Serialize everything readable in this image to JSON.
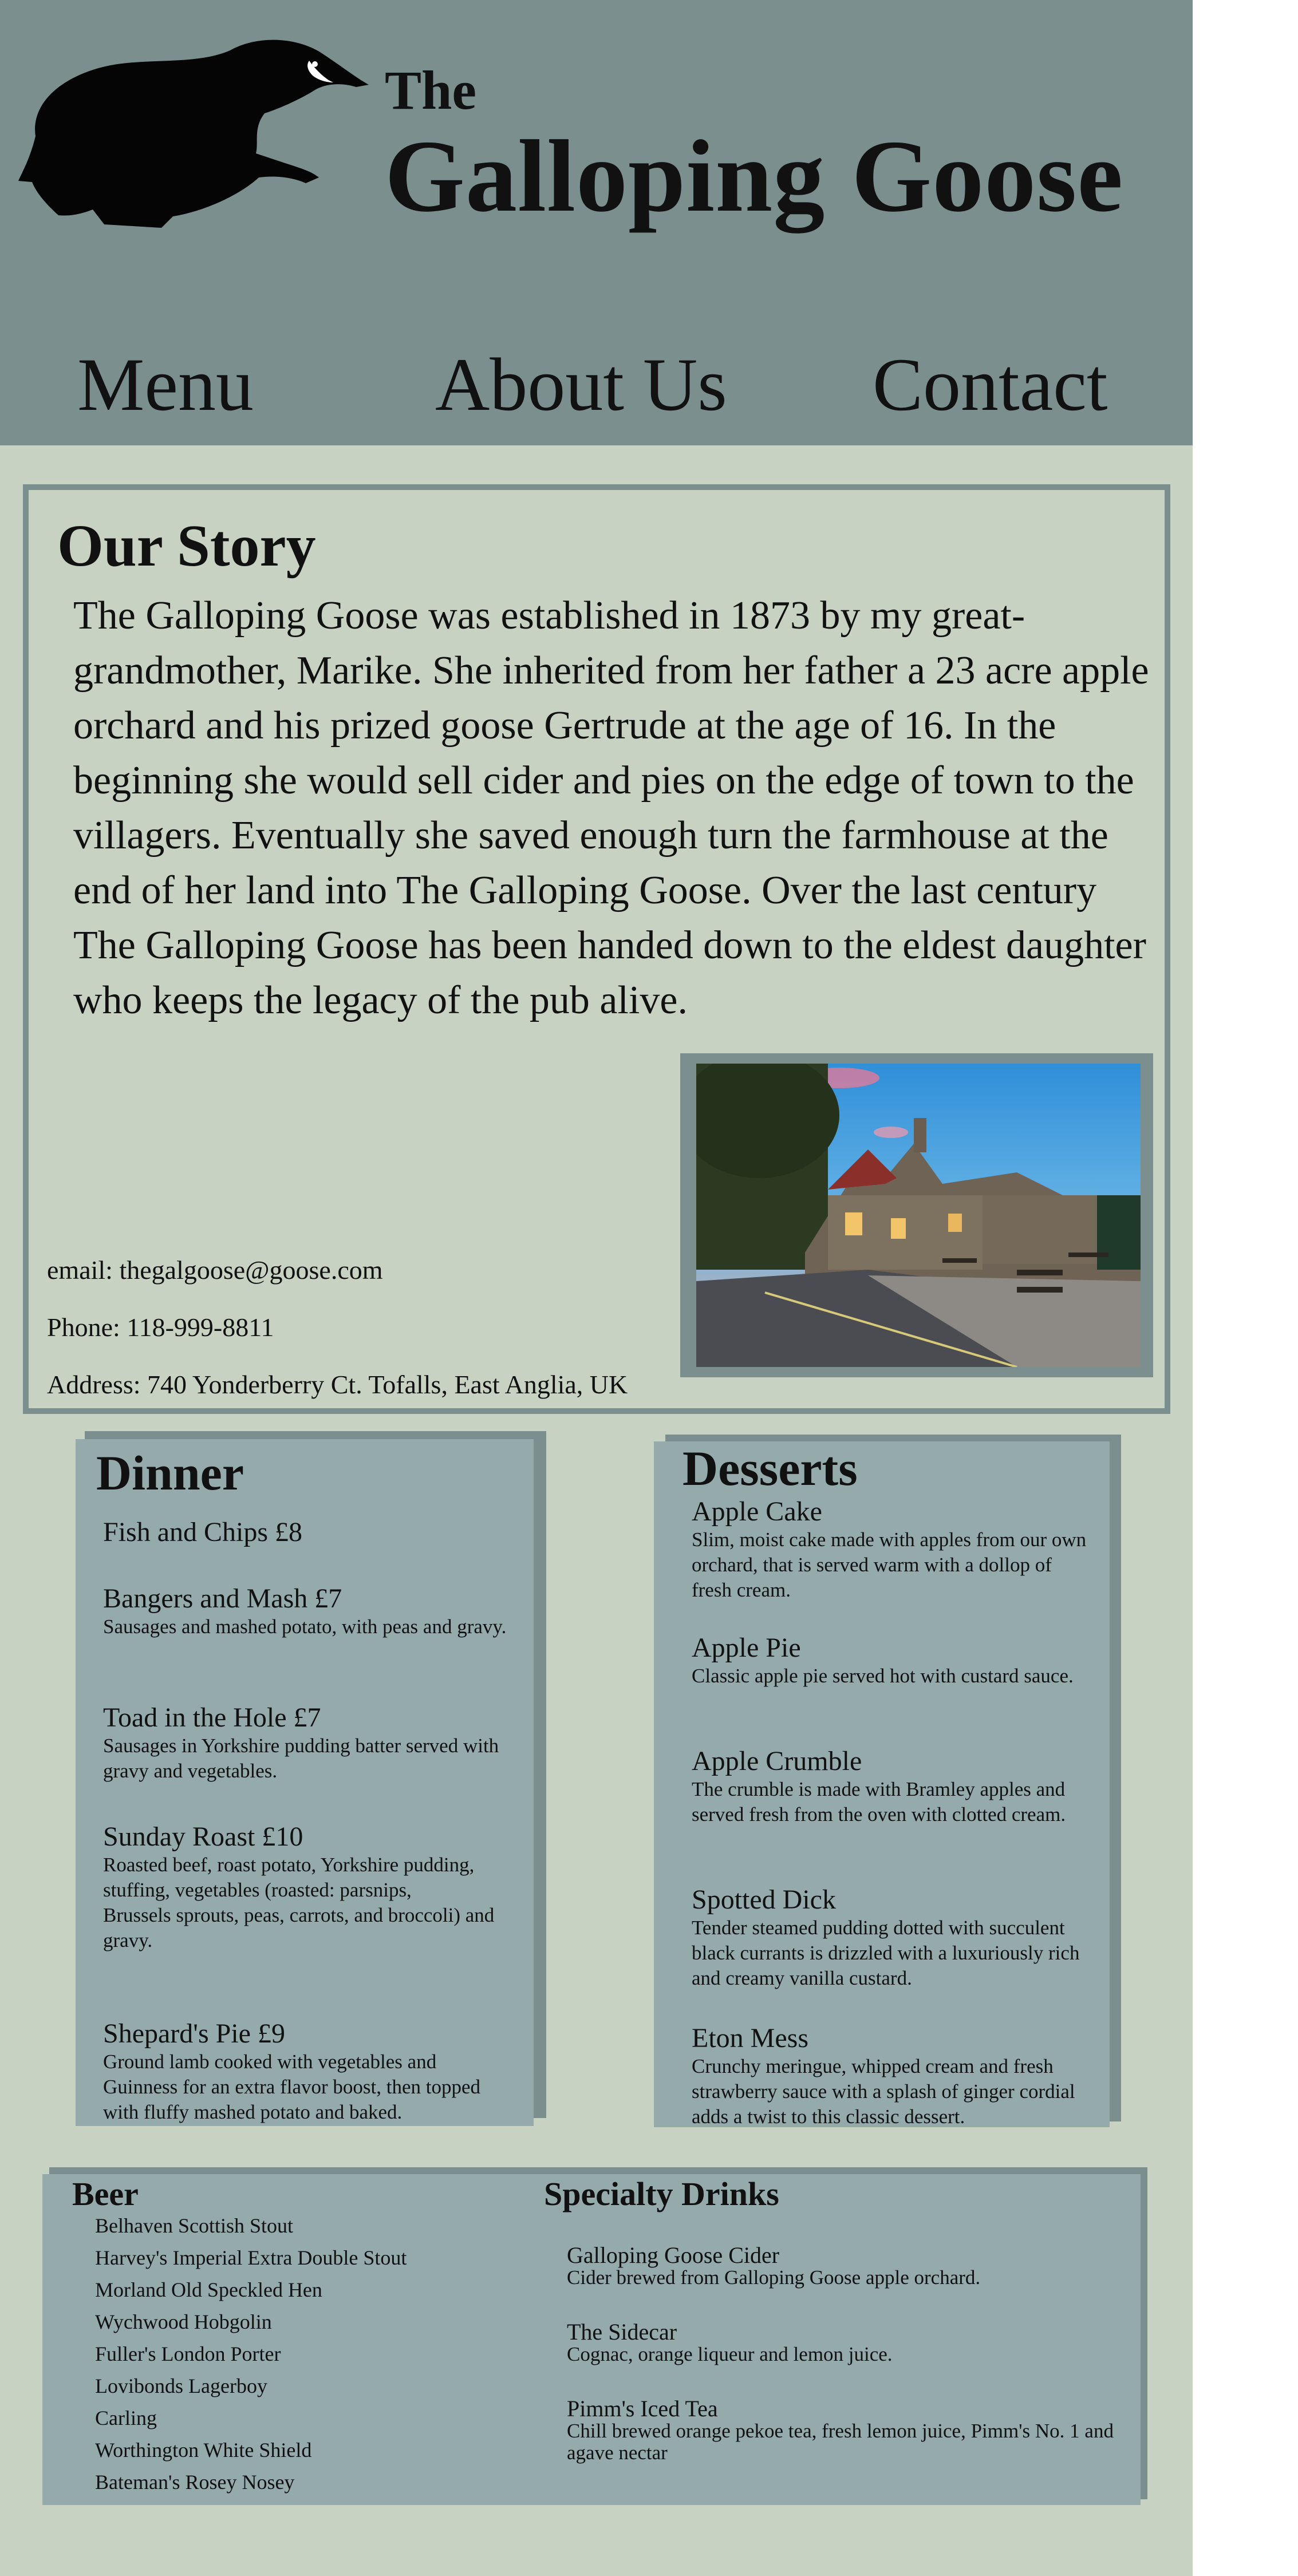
{
  "brand": {
    "the": "The",
    "name": "Galloping Goose",
    "logo_icon": "goose-silhouette-icon"
  },
  "nav": {
    "menu": "Menu",
    "about": "About Us",
    "contact": "Contact"
  },
  "story": {
    "title": "Our Story",
    "body": "The Galloping Goose was established in 1873 by my great-grandmother, Marike. She inherited from her father a 23 acre apple orchard and his prized goose Gertrude at the age of 16. In the beginning she would sell cider and pies on the edge of town to the villagers. Eventually she saved enough turn the farmhouse at the end of her land into The Galloping Goose. Over the last century The Galloping Goose has been handed down to the eldest daughter who keeps the legacy of the pub alive.",
    "email": "email: thegalgoose@goose.com",
    "phone": "Phone: 118-999-8811",
    "address": "Address: 740 Yonderberry Ct. Tofalls, East Anglia, UK"
  },
  "dinner": {
    "title": "Dinner",
    "items": [
      {
        "name": "Fish and Chips £8",
        "desc": ""
      },
      {
        "name": "Bangers and Mash £7",
        "desc": "Sausages and mashed potato, with peas and gravy."
      },
      {
        "name": "Toad in the Hole £7",
        "desc": "Sausages in Yorkshire pudding batter served with gravy and vegetables."
      },
      {
        "name": "Sunday Roast £10",
        "desc": "Roasted beef, roast potato, Yorkshire pudding, stuffing, vegetables (roasted: parsnips,",
        "desc2": "Brussels sprouts, peas, carrots, and broccoli) and gravy."
      },
      {
        "name": "Shepard's Pie £9",
        "desc": "Ground lamb cooked with vegetables and Guinness for an extra flavor boost, then topped with fluffy mashed potato and baked."
      }
    ]
  },
  "desserts": {
    "title": "Desserts",
    "items": [
      {
        "name": "Apple Cake",
        "desc": "Slim, moist cake made with apples from our own orchard, that is served warm with a dollop of fresh cream."
      },
      {
        "name": "Apple Pie",
        "desc": "Classic apple pie served hot with custard sauce."
      },
      {
        "name": "Apple Crumble",
        "desc": "The crumble is made with Bramley apples and served fresh from the oven with clotted cream."
      },
      {
        "name": "Spotted Dick",
        "desc": "Tender steamed pudding dotted with succulent black currants is drizzled with a luxuriously rich and creamy vanilla custard."
      },
      {
        "name": "Eton Mess",
        "desc": "Crunchy meringue, whipped cream and fresh strawberry sauce with a splash of ginger cordial adds a twist to this classic dessert."
      }
    ]
  },
  "beer": {
    "title": "Beer",
    "items": [
      "Belhaven Scottish Stout",
      "Harvey's Imperial Extra Double Stout",
      "Morland Old Speckled Hen",
      "Wychwood Hobgolin",
      "Fuller's London Porter",
      "Lovibonds Lagerboy",
      "Carling",
      "Worthington White Shield",
      "Bateman's Rosey Nosey"
    ]
  },
  "specialty": {
    "title": "Specialty Drinks",
    "items": [
      {
        "name": "Galloping Goose Cider",
        "desc": "Cider brewed from Galloping Goose apple orchard."
      },
      {
        "name": "The Sidecar",
        "desc": "Cognac, orange liqueur and lemon juice."
      },
      {
        "name": "Pimm's Iced Tea",
        "desc": "Chill brewed orange pekoe tea, fresh lemon juice, Pimm's No. 1 and agave nectar"
      }
    ]
  },
  "colors": {
    "header": "#7a8f8e",
    "page": "#c7d2c3",
    "card": "#94aaab",
    "text": "#111111"
  }
}
